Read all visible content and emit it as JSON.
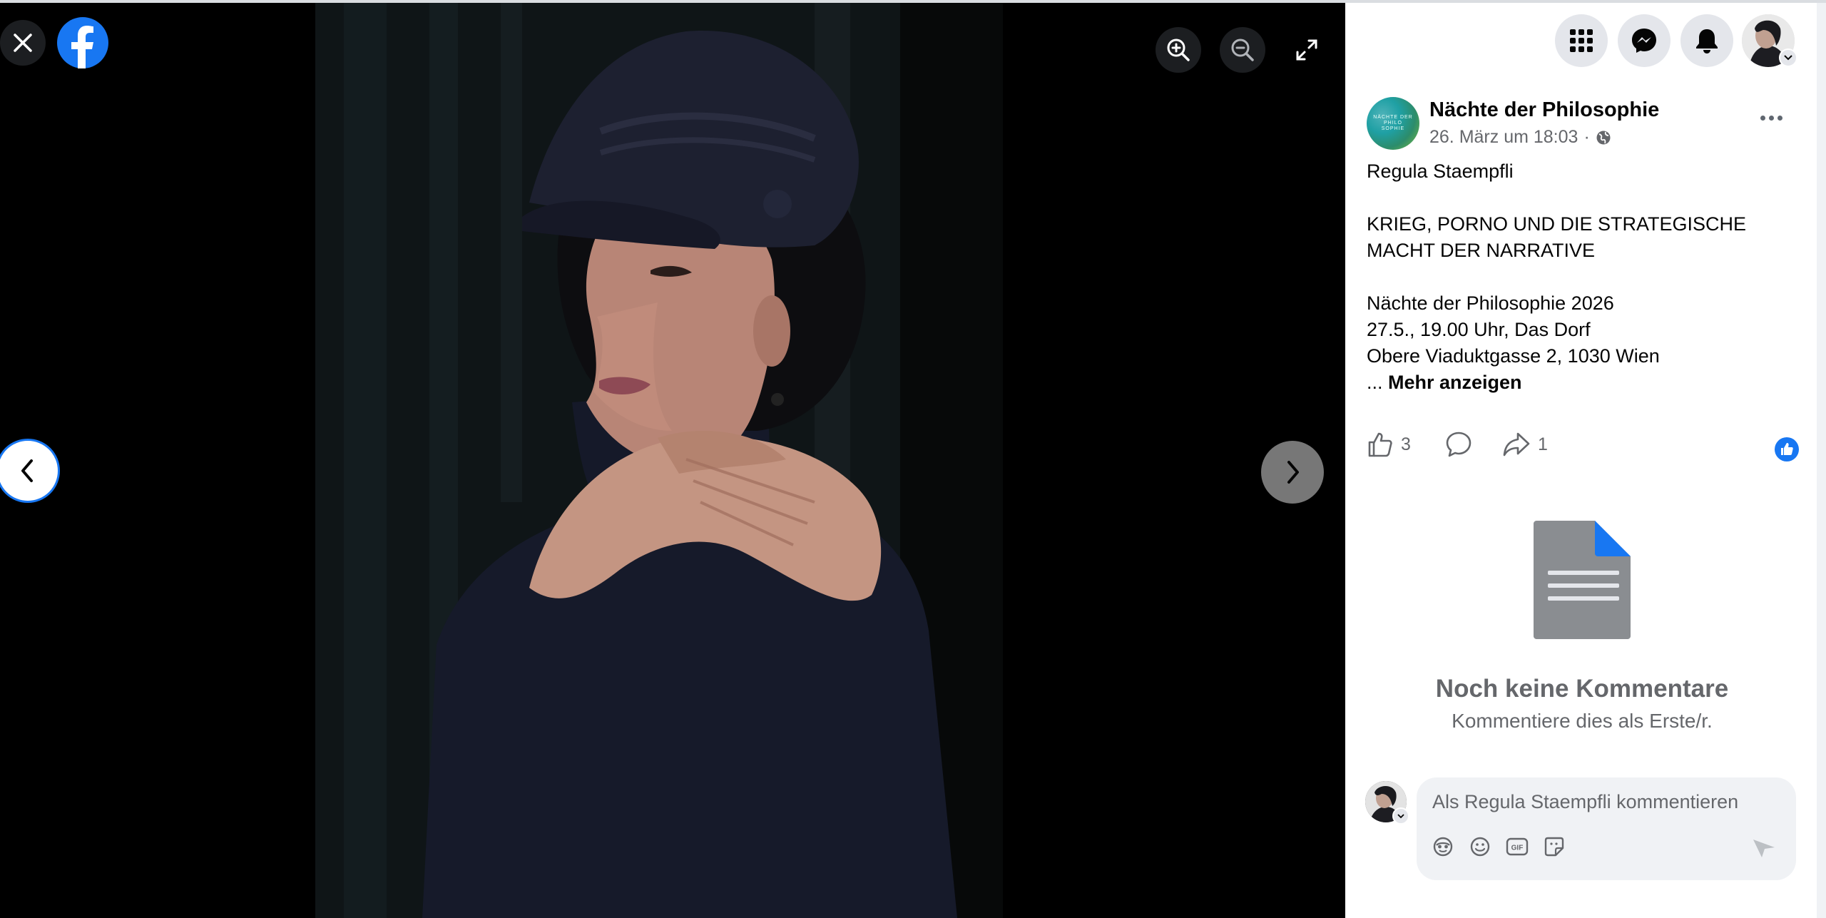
{
  "viewer": {
    "close_icon": "close-icon",
    "logo_icon": "facebook-logo-icon",
    "zoom_in_icon": "zoom-in-icon",
    "zoom_out_icon": "zoom-out-icon",
    "fullscreen_icon": "fullscreen-icon",
    "prev_icon": "chevron-left-icon",
    "next_icon": "chevron-right-icon"
  },
  "topnav": {
    "icons": [
      "menu-grid-icon",
      "messenger-icon",
      "notifications-bell-icon",
      "account-avatar"
    ]
  },
  "post": {
    "page_name": "Nächte der Philosophie",
    "avatar_text": [
      "NÄCHTE DER",
      "PHILO",
      "SOPHIE"
    ],
    "date": "26. März um 18:03",
    "separator": "·",
    "audience_icon": "globe-icon",
    "lines": [
      "Regula Staempfli",
      "",
      "KRIEG, PORNO UND DIE STRATEGISCHE",
      "MACHT DER NARRATIVE",
      "",
      "Nächte der Philosophie 2026",
      "27.5., 19.00 Uhr, Das Dorf",
      "Obere Viaduktgasse 2, 1030 Wien"
    ],
    "see_more_prefix": "... ",
    "see_more": "Mehr anzeigen"
  },
  "actions": {
    "like_count": "3",
    "share_count": "1"
  },
  "comments": {
    "empty_title": "Noch keine Kommentare",
    "empty_subtitle": "Kommentiere dies als Erste/r.",
    "placeholder": "Als Regula Staempfli kommentieren"
  },
  "colors": {
    "accent": "#1877f2",
    "secondary_text": "#65676b",
    "viewer_bg": "#000000"
  }
}
